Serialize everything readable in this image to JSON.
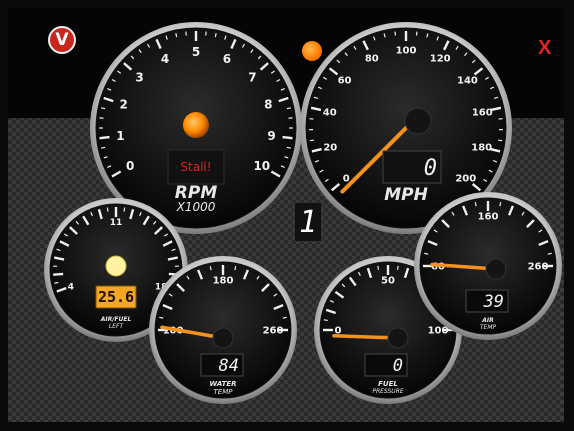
{
  "header": {
    "logo_letter": "V",
    "close_label": "X"
  },
  "gear": {
    "value": "1"
  },
  "gauges": {
    "rpm": {
      "tick_labels": [
        "0",
        "1",
        "2",
        "3",
        "4",
        "5",
        "6",
        "7",
        "8",
        "9",
        "10"
      ],
      "caption_main": "RPM",
      "caption_sub": "X1000",
      "status_text": "Stall!",
      "value": 0
    },
    "mph": {
      "tick_labels": [
        "0",
        "20",
        "40",
        "60",
        "80",
        "100",
        "120",
        "140",
        "160",
        "180",
        "200"
      ],
      "caption_main": "MPH",
      "readout": "0",
      "value": 0
    },
    "afr": {
      "tick_labels": [
        "4",
        "11",
        "18"
      ],
      "readout": "25.6",
      "caption_main": "AIR/FUEL",
      "caption_sub": "LEFT"
    },
    "water_temp": {
      "tick_labels": [
        "100",
        "180",
        "260"
      ],
      "readout": "84",
      "caption_main": "WATER",
      "caption_sub": "TEMP",
      "value": 100
    },
    "fuel_pressure": {
      "tick_labels": [
        "0",
        "50",
        "100"
      ],
      "readout": "0",
      "caption_main": "FUEL",
      "caption_sub": "PRESSURE",
      "value": 0
    },
    "air_temp": {
      "tick_labels": [
        "60",
        "160",
        "260"
      ],
      "readout": "39",
      "caption_main": "AIR",
      "caption_sub": "TEMP",
      "value": 60
    }
  },
  "colors": {
    "needle": "#f5921e",
    "status_red": "#e02020",
    "digit_amber": "#f5a623"
  }
}
